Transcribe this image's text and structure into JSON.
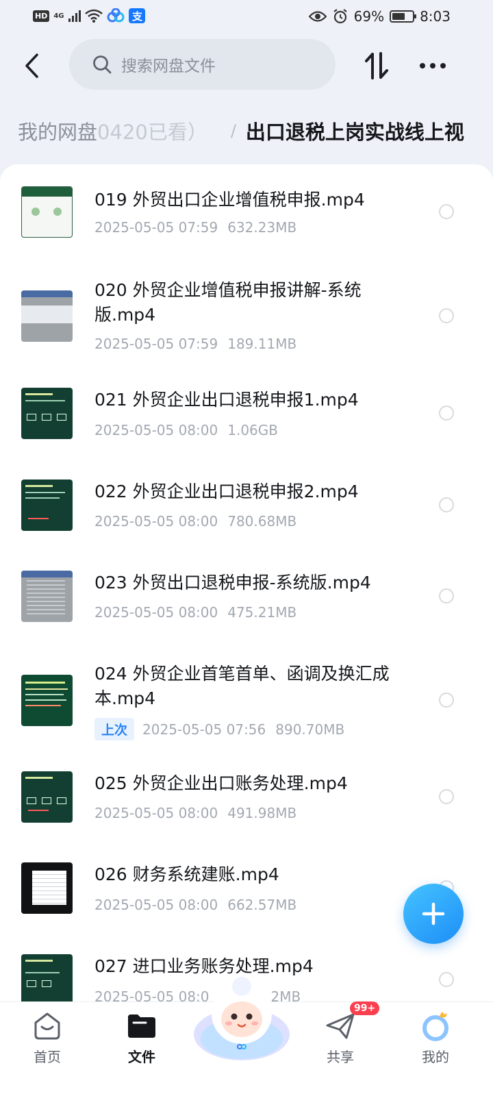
{
  "status_bar": {
    "hd": "HD",
    "network": "4G",
    "battery": "69%",
    "time": "8:03"
  },
  "header": {
    "search_placeholder": "搜索网盘文件",
    "back_icon": "chevron-left-icon",
    "sort_icon": "sort-arrows-icon",
    "more_icon": "more-dots-icon"
  },
  "breadcrumb": {
    "root": "我的网盘",
    "previous": "0420已看）",
    "separator": "/",
    "current": "出口退税上岗实战线上视"
  },
  "files": [
    {
      "name": "019 外贸出口企业增值税申报.mp4",
      "date": "2025-05-05  07:59",
      "size": "632.23MB",
      "thumb": "white"
    },
    {
      "name": "020 外贸企业增值税申报讲解-系统版.mp4",
      "date": "2025-05-05  07:59",
      "size": "189.11MB",
      "thumb": "gray"
    },
    {
      "name": "021 外贸企业出口退税申报1.mp4",
      "date": "2025-05-05  08:00",
      "size": "1.06GB",
      "thumb": "green"
    },
    {
      "name": "022 外贸企业出口退税申报2.mp4",
      "date": "2025-05-05  08:00",
      "size": "780.68MB",
      "thumb": "green"
    },
    {
      "name": "023 外贸出口退税申报-系统版.mp4",
      "date": "2025-05-05  08:00",
      "size": "475.21MB",
      "thumb": "gray"
    },
    {
      "name": "024 外贸企业首笔首单、函调及换汇成本.mp4",
      "date": "2025-05-05  07:56",
      "size": "890.70MB",
      "thumb": "green",
      "tag": "上次"
    },
    {
      "name": "025 外贸企业出口账务处理.mp4",
      "date": "2025-05-05  08:00",
      "size": "491.98MB",
      "thumb": "green"
    },
    {
      "name": "026 财务系统建账.mp4",
      "date": "2025-05-05  08:00",
      "size": "662.57MB",
      "thumb": "dark"
    },
    {
      "name": "027 进口业务账务处理.mp4",
      "date": "2025-05-05  08:0",
      "size": "2MB",
      "thumb": "green"
    }
  ],
  "nav": {
    "home": "首页",
    "files": "文件",
    "share": "共享",
    "mine": "我的",
    "share_badge": "99+"
  },
  "colors": {
    "accent": "#2a84f3",
    "fab": "#1d8ef7",
    "badge": "#fa3f4f"
  }
}
